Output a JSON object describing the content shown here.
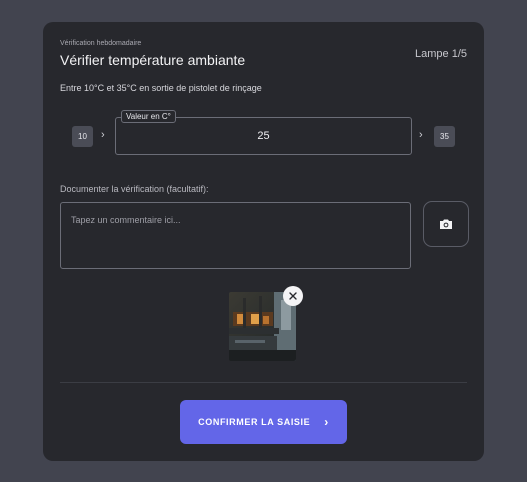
{
  "card": {
    "eyebrow": "Vérification hebdomadaire",
    "title": "Vérifier température ambiante",
    "counter": "Lampe 1/5",
    "range_text": "Entre 10°C et 35°C en sortie de pistolet de rinçage"
  },
  "value_input": {
    "min": "10",
    "max": "35",
    "legend": "Valeur en C°",
    "value": "25",
    "min_chevron": "›",
    "max_chevron": "›"
  },
  "documentation": {
    "label": "Documenter la vérification (facultatif):",
    "placeholder": "Tapez un commentaire ici..."
  },
  "icons": {
    "camera": "camera-icon",
    "close": "close-icon",
    "chevron": "chevron-right-icon"
  },
  "actions": {
    "confirm_label": "CONFIRMER LA SAISIE",
    "confirm_chevron": "›"
  },
  "colors": {
    "background": "#42444f",
    "card": "#27282d",
    "accent": "#6366e8"
  }
}
